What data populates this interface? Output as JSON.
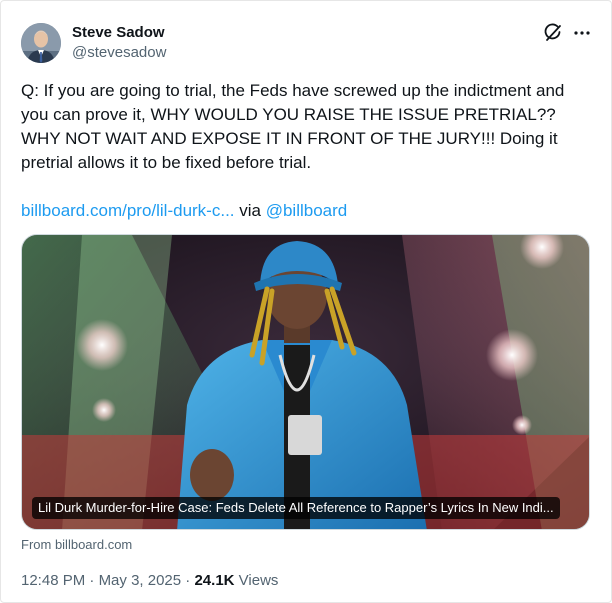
{
  "author": {
    "name": "Steve Sadow",
    "handle": "@stevesadow",
    "avatar_icon": "profile-photo"
  },
  "header_icons": [
    "grok-icon",
    "more-icon"
  ],
  "post": {
    "text": "Q: If you are going to trial, the Feds have screwed up the indictment and you can prove it, WHY WOULD YOU RAISE THE ISSUE PRETRIAL?? WHY NOT WAIT AND EXPOSE IT IN FRONT OF THE JURY!!! Doing it pretrial allows it to be fixed before trial.",
    "link_url": "billboard.com/pro/lil-durk-c...",
    "link_via": " via ",
    "link_mention": "@billboard"
  },
  "card": {
    "title": "Lil Durk Murder-for-Hire Case: Feds Delete All Reference to Rapper’s Lyrics In New Indi...",
    "source": "From billboard.com"
  },
  "meta": {
    "time": "12:48 PM",
    "separator1": " · ",
    "date": "May 3, 2025",
    "separator2": " · ",
    "views_count": "24.1K",
    "views_label": " Views"
  },
  "colors": {
    "link": "#1d9bf0",
    "secondary_text": "#536471",
    "primary_text": "#0f1419"
  }
}
